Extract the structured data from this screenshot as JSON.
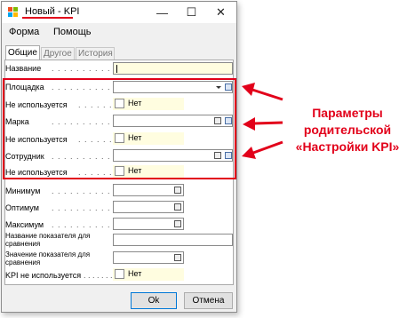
{
  "window": {
    "title": "Новый - KPI",
    "controls": {
      "minimize": "—",
      "maximize": "☐",
      "close": "✕"
    }
  },
  "menu": {
    "form": "Форма",
    "help": "Помощь"
  },
  "tabs": [
    {
      "label": "Общие",
      "active": true
    },
    {
      "label": "Другое",
      "active": false
    },
    {
      "label": "История",
      "active": false
    }
  ],
  "form": {
    "name_label": "Название",
    "site_label": "Площадка",
    "not_used_label": "Не используется",
    "brand_label": "Марка",
    "employee_label": "Сотрудник",
    "minimum_label": "Минимум",
    "optimum_label": "Оптимум",
    "maximum_label": "Максимум",
    "cmp_name_label_1": "Название показателя для",
    "cmp_name_label_2": "сравнения",
    "cmp_value_label_1": "Значение показателя для",
    "cmp_value_label_2": "сравнения",
    "kpi_not_used_label": "KPI не используется",
    "no_label": "Нет",
    "leader_dots": ". . . . . . . . . ."
  },
  "buttons": {
    "ok": "Ok",
    "cancel": "Отмена"
  },
  "annotation": {
    "line1": "Параметры",
    "line2": "родительской",
    "line3": "«Настройки KPI»"
  },
  "colors": {
    "accent_red": "#e2001a",
    "input_yellow": "#fffde0",
    "ok_border": "#0078d7"
  }
}
